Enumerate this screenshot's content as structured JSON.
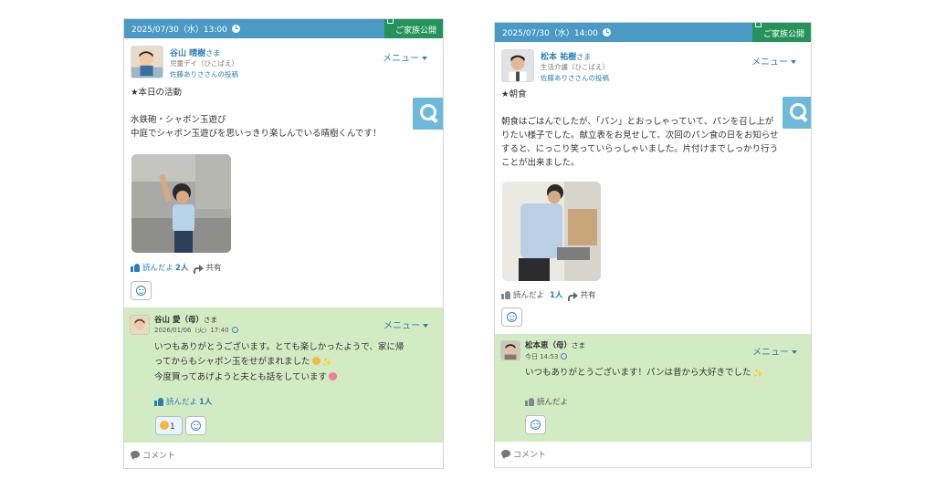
{
  "colors": {
    "header": "#4a9ac5",
    "badge": "#23935a",
    "link": "#2a7fb8",
    "comment_bg": "#d2ebc3",
    "search": "#6eb9d9"
  },
  "posts": [
    {
      "datetime": "2025/07/30（水）13:00",
      "badge": "ご家族公開",
      "poster_name": "谷山 晴樹",
      "poster_honorific": "さま",
      "service": "児童デイ（ひこばえ）",
      "posted_by": "佐藤ありささんの投稿",
      "menu": "メニュー",
      "body": "★本日の活動\n\n水鉄砲・シャボン玉遊び\n中庭でシャボン玉遊びを思いっきり楽しんでいる晴樹くんです！",
      "read_label": "読んだよ",
      "read_count": "2人",
      "share_label": "共有",
      "comment": {
        "name": "谷山 愛（母）",
        "honorific": "さま",
        "date": "2026/01/06（火）17:40",
        "menu": "メニュー",
        "line1": "いつもありがとうございます。とても楽しかったようで、家に帰",
        "line2": "ってからもシャボン玉をせがまれました",
        "line3": "今度買ってあげようと夫とも話をしています",
        "read_label": "読んだよ",
        "read_count": "1人",
        "reaction_count": "1"
      },
      "footer": "コメント"
    },
    {
      "datetime": "2025/07/30（水）14:00",
      "badge": "ご家族公開",
      "poster_name": "松本 祐樹",
      "poster_honorific": "さま",
      "service": "生活介護（ひこばえ）",
      "posted_by": "佐藤ありささんの投稿",
      "menu": "メニュー",
      "body": "★朝食\n\n朝食はごはんでしたが、「パン」とおっしゃっていて、パンを召し上が\nりたい様子でした。献立表をお見せして、次回のパン食の日をお知らせ\nすると、にっこり笑っていらっしゃいました。片付けまでしっかり行う\nことが出来ました。",
      "read_label": "読んだよ",
      "read_count": "1人",
      "share_label": "共有",
      "comment": {
        "name": "松本恵（母）",
        "honorific": "さま",
        "date": "今日 14:53",
        "menu": "メニュー",
        "line1": "いつもありがとうございます！パンは昔から大好きでした",
        "read_label": "読んだよ"
      },
      "footer": "コメント"
    }
  ]
}
